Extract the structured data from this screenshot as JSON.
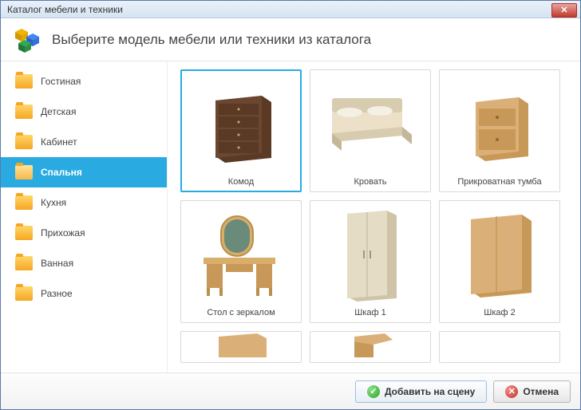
{
  "window_title": "Каталог мебели и техники",
  "header_title": "Выберите модель мебели или техники из каталога",
  "categories": [
    {
      "label": "Гостиная"
    },
    {
      "label": "Детская"
    },
    {
      "label": "Кабинет"
    },
    {
      "label": "Спальня"
    },
    {
      "label": "Кухня"
    },
    {
      "label": "Прихожая"
    },
    {
      "label": "Ванная"
    },
    {
      "label": "Разное"
    }
  ],
  "selected_category_index": 3,
  "items": [
    {
      "label": "Комод"
    },
    {
      "label": "Кровать"
    },
    {
      "label": "Прикроватная тумба"
    },
    {
      "label": "Стол с зеркалом"
    },
    {
      "label": "Шкаф 1"
    },
    {
      "label": "Шкаф 2"
    }
  ],
  "selected_item_index": 0,
  "buttons": {
    "add": "Добавить на сцену",
    "cancel": "Отмена"
  }
}
